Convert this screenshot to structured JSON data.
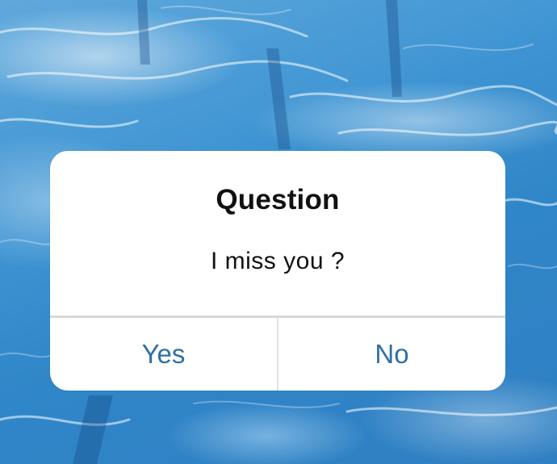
{
  "dialog": {
    "title": "Question",
    "message": "I miss you ?",
    "buttons": {
      "yes_label": "Yes",
      "no_label": "No"
    }
  },
  "colors": {
    "background_water": "#3f95d3",
    "dialog_background": "#ffffff",
    "button_text": "#2f6fa3",
    "title_text": "#111111",
    "divider": "#d8d8d8"
  }
}
